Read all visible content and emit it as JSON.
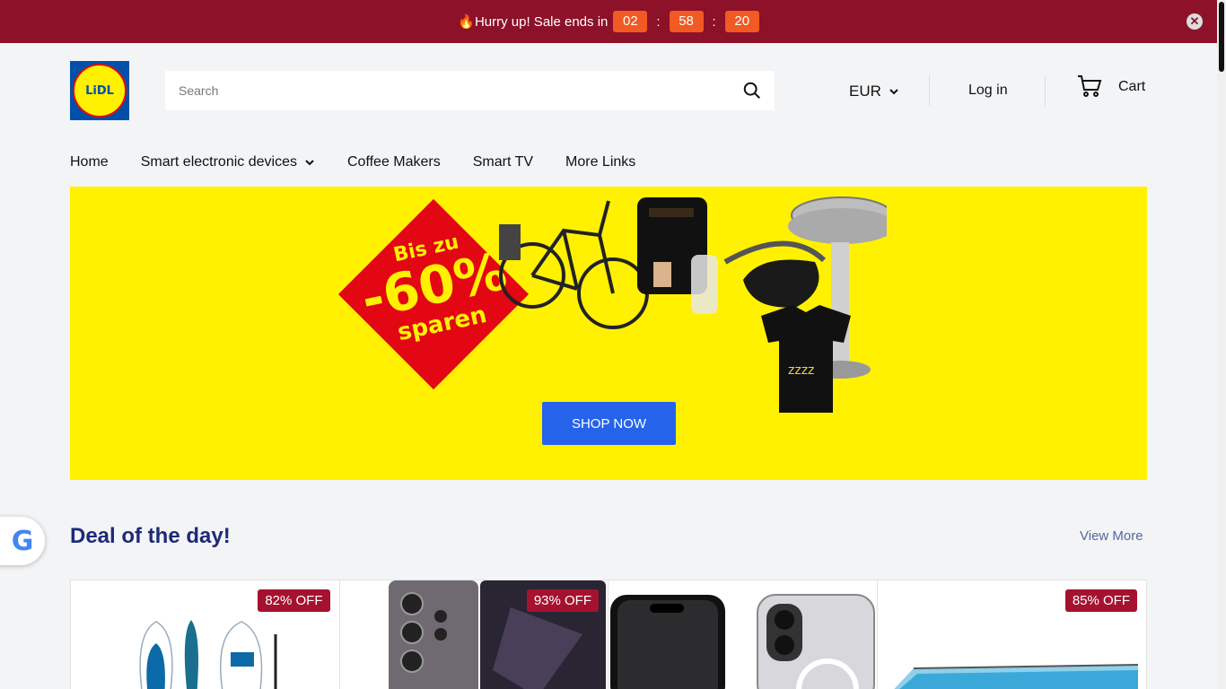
{
  "announcement": {
    "text": "🔥Hurry up! Sale ends in",
    "hours": "02",
    "minutes": "58",
    "seconds": "20",
    "separator": ":"
  },
  "header": {
    "logo_text": "LiDL",
    "search_placeholder": "Search",
    "currency": "EUR",
    "login_label": "Log in",
    "cart_label": "Cart"
  },
  "nav": {
    "items": [
      {
        "label": "Home"
      },
      {
        "label": "Smart electronic devices"
      },
      {
        "label": "Coffee Makers"
      },
      {
        "label": "Smart TV"
      },
      {
        "label": "More Links"
      }
    ]
  },
  "hero": {
    "badge_line1": "Bis zu",
    "badge_line2": "-60%",
    "badge_line3": "sparen",
    "button_label": "SHOP NOW",
    "background_color": "#fff100"
  },
  "deal": {
    "title": "Deal of the day!",
    "view_more": "View More",
    "cards": [
      {
        "discount": "82% OFF",
        "icon": "paddle-board-image"
      },
      {
        "discount": "93% OFF",
        "icon": "smartphone-image"
      },
      {
        "discount": "",
        "icon": "iphone-case-image"
      },
      {
        "discount": "85% OFF",
        "icon": "pool-image"
      }
    ]
  },
  "colors": {
    "announcement_bg": "#8c1129",
    "timer_bg": "#f15a22",
    "primary_button": "#2563eb",
    "deal_title": "#1e2a78",
    "discount_badge": "#a5122f"
  }
}
